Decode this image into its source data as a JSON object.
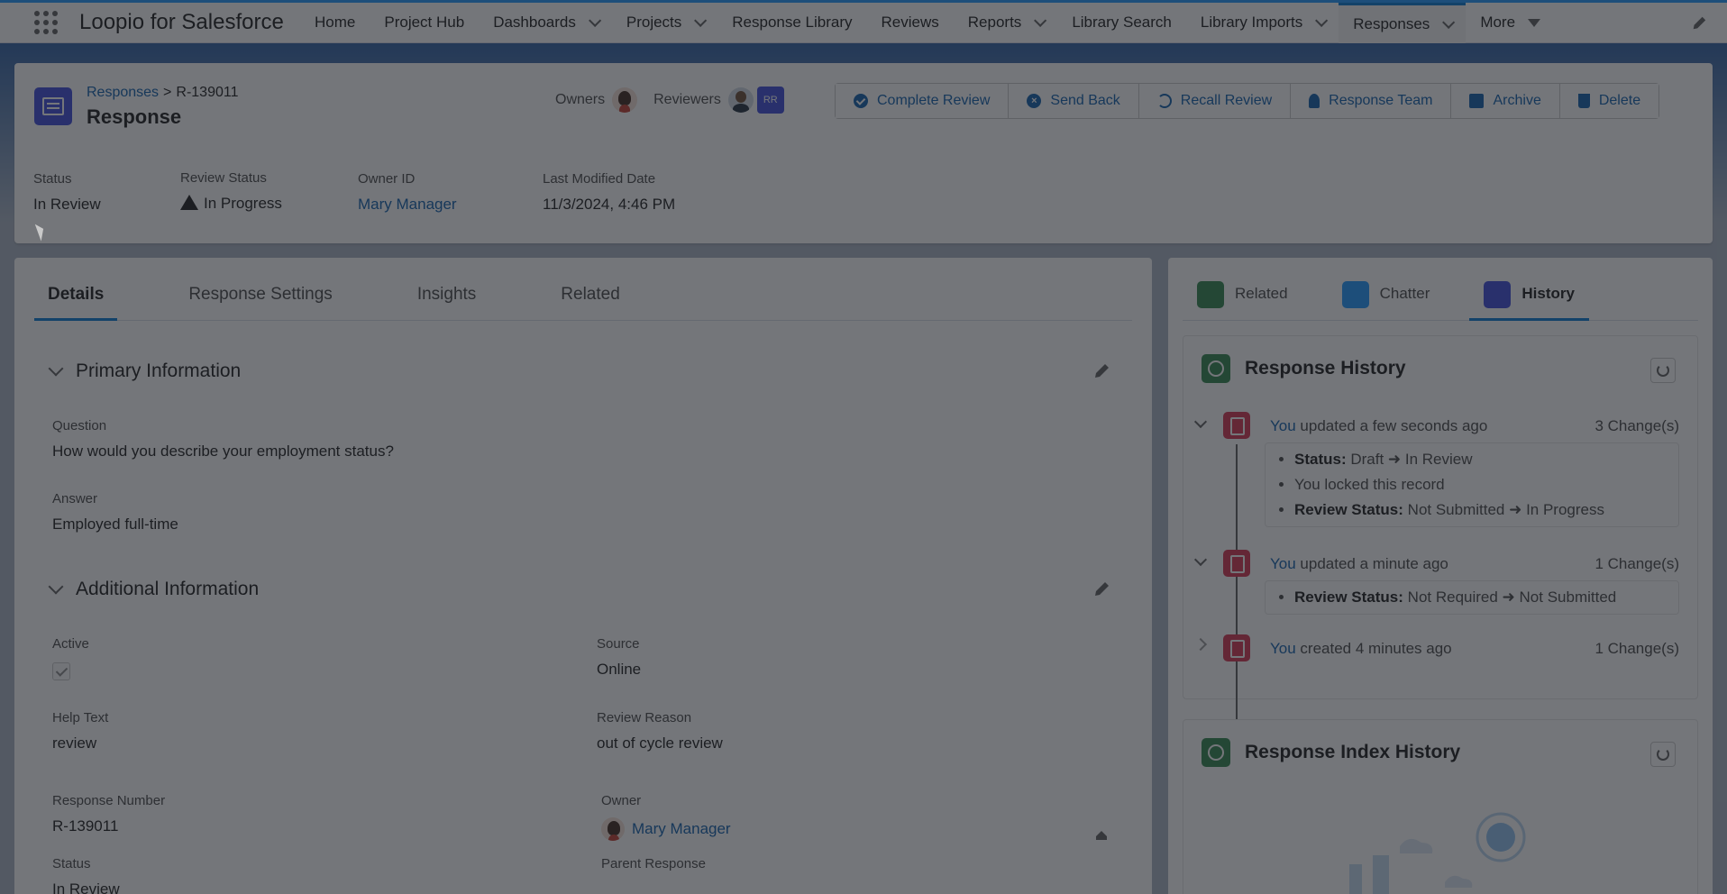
{
  "nav": {
    "app_name": "Loopio for Salesforce",
    "items": [
      {
        "label": "Home",
        "dropdown": false
      },
      {
        "label": "Project Hub",
        "dropdown": false
      },
      {
        "label": "Dashboards",
        "dropdown": true
      },
      {
        "label": "Projects",
        "dropdown": true
      },
      {
        "label": "Response Library",
        "dropdown": false
      },
      {
        "label": "Reviews",
        "dropdown": false
      },
      {
        "label": "Reports",
        "dropdown": true
      },
      {
        "label": "Library Search",
        "dropdown": false
      },
      {
        "label": "Library Imports",
        "dropdown": true
      },
      {
        "label": "Responses",
        "dropdown": true,
        "active": true
      }
    ],
    "more_label": "More"
  },
  "header": {
    "breadcrumb_parent": "Responses",
    "breadcrumb_sep": ">",
    "breadcrumb_current": "R-139011",
    "title": "Response",
    "owners_label": "Owners",
    "reviewers_label": "Reviewers",
    "reviewer_initials": "RR",
    "actions": {
      "complete_review": "Complete Review",
      "send_back": "Send Back",
      "recall_review": "Recall Review",
      "response_team": "Response Team",
      "archive": "Archive",
      "delete": "Delete"
    },
    "highlights": {
      "status_label": "Status",
      "status_value": "In Review",
      "review_status_label": "Review Status",
      "review_status_value": "In Progress",
      "owner_id_label": "Owner ID",
      "owner_id_value": "Mary Manager",
      "last_modified_label": "Last Modified Date",
      "last_modified_value": "11/3/2024, 4:46 PM"
    }
  },
  "details": {
    "tabs": [
      "Details",
      "Response Settings",
      "Insights",
      "Related"
    ],
    "primary_section": "Primary Information",
    "question_label": "Question",
    "question_value": "How would you describe your employment status?",
    "answer_label": "Answer",
    "answer_value": "Employed full-time",
    "additional_section": "Additional Information",
    "active_label": "Active",
    "source_label": "Source",
    "source_value": "Online",
    "help_text_label": "Help Text",
    "help_text_value": "review",
    "review_reason_label": "Review Reason",
    "review_reason_value": "out of cycle review",
    "response_number_label": "Response Number",
    "response_number_value": "R-139011",
    "owner_label": "Owner",
    "owner_value": "Mary Manager",
    "status_label": "Status",
    "status_value": "In Review",
    "parent_response_label": "Parent Response"
  },
  "sidebar": {
    "tabs": {
      "related": "Related",
      "chatter": "Chatter",
      "history": "History"
    },
    "response_history": {
      "title": "Response History",
      "entries": [
        {
          "who": "You",
          "action": " updated a few seconds ago",
          "changes": "3 Change(s)",
          "details": [
            {
              "field": "Status:",
              "change": " Draft ➜ In Review"
            },
            {
              "field": "",
              "change": "You locked this record"
            },
            {
              "field": "Review Status:",
              "change": " Not Submitted ➜ In Progress"
            }
          ]
        },
        {
          "who": "You",
          "action": " updated a minute ago",
          "changes": "1 Change(s)",
          "details": [
            {
              "field": "Review Status:",
              "change": " Not Required ➜ Not Submitted"
            }
          ]
        },
        {
          "who": "You",
          "action": " created 4 minutes ago",
          "changes": "1 Change(s)"
        }
      ]
    },
    "response_index_history": {
      "title": "Response Index History"
    }
  }
}
